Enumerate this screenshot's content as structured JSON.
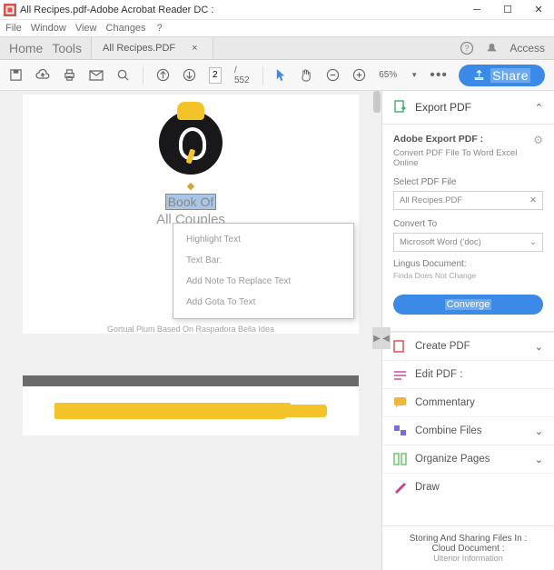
{
  "window": {
    "title": "All Recipes.pdf-Adobe Acrobat Reader DC :"
  },
  "menu": {
    "file": "File",
    "window": "Window",
    "view": "View",
    "changes": "Changes",
    "help": "?"
  },
  "tabs": {
    "home": "Home",
    "tools": "Tools",
    "file_tab": "All Recipes.PDF",
    "close": "×",
    "access": "Access"
  },
  "toolbar": {
    "page_current": "2",
    "page_total": "/ 552",
    "zoom": "65%",
    "share": "Share"
  },
  "document": {
    "book_of": "Book Of",
    "subtitle": "All Couples",
    "caption": "Gortual Plum Based On Raspadora Bella Idea"
  },
  "context_menu": {
    "items": [
      "Highlight Text",
      "Text Bar:",
      "Add Note To Replace Text",
      "Add Gota To Text"
    ]
  },
  "panel": {
    "export_hdr": "Export PDF",
    "adobe_export": "Adobe Export PDF :",
    "adobe_export_sub": "Convert PDF File To Word Excel Online",
    "select_file_lbl": "Select PDF File",
    "selected_file": "All Recipes.PDF",
    "convert_to_lbl": "Convert To",
    "convert_to_val": "Microsoft Word ('doc)",
    "lingus_lbl": "Lingus Document:",
    "lingus_sub": "Finda Does Not Change",
    "convert_btn": "Converge",
    "tools": [
      {
        "label": "Create PDF",
        "color": "#d9534f",
        "chev": true
      },
      {
        "label": "Edit PDF :",
        "color": "#d97ab6",
        "chev": false
      },
      {
        "label": "Commentary",
        "color": "#f0b53a",
        "chev": false
      },
      {
        "label": "Combine Files",
        "color": "#7a6fd8",
        "chev": true
      },
      {
        "label": "Organize Pages",
        "color": "#6ec56e",
        "chev": true
      },
      {
        "label": "Draw",
        "color": "#c43f9e",
        "chev": false
      }
    ],
    "footer1": "Storing And Sharing Files In :",
    "footer2": "Cloud Document :",
    "footer3": "Ulterior Information"
  }
}
